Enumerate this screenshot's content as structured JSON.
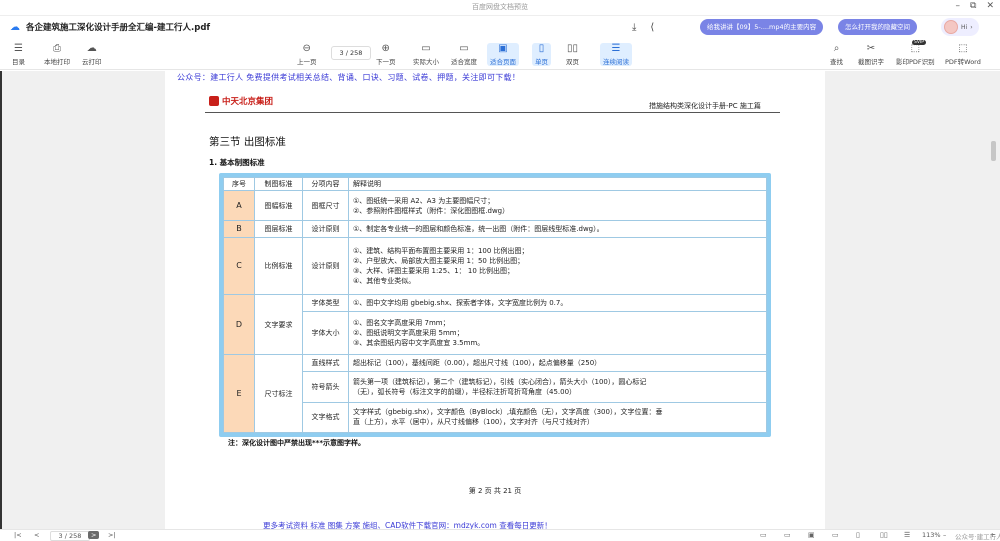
{
  "window": {
    "title": "百度网盘文档预览",
    "minimize": "–",
    "restore": "⧉",
    "close": "✕"
  },
  "file": {
    "name": "各企建筑施工深化设计手册全汇编-建工行人.pdf"
  },
  "header": {
    "download_icon": "download-icon",
    "share_icon": "share-icon",
    "pill1": "给我讲讲【09】5-....mp4的主要内容",
    "pill2": "怎么打开我的隐藏空间",
    "avatar_label": "Hi",
    "assistant_more": "›"
  },
  "toolbar": {
    "left": [
      {
        "label": "目录",
        "icon": "☰"
      },
      {
        "label": "本地打印",
        "icon": "⎙"
      },
      {
        "label": "云打印",
        "icon": "☁"
      }
    ],
    "prev": "上一页",
    "page_current": "3",
    "page_total": "/ 258",
    "next": "下一页",
    "actual_size": "实际大小",
    "fit_width": "适合宽度",
    "fit_page": "适合页面",
    "single_page": "单页",
    "double_page": "双页",
    "continuous": "连续阅读",
    "right": [
      {
        "label": "查找",
        "icon": "⌕"
      },
      {
        "label": "截图识字",
        "icon": "✂"
      },
      {
        "label": "影印PDF识别",
        "icon": "⬚"
      },
      {
        "label": "PDF转Word",
        "icon": "⬚"
      }
    ],
    "svip_badge": "SVIP"
  },
  "document": {
    "notice": "公众号：建工行人 免费提供考试相关总结、背诵、口诀、习题、试卷、押题，关注即可下载！",
    "logo_text": "中天北京集团",
    "header_title": "措施结构类深化设计手册-PC 施工篇",
    "section_title": "第三节  出图标准",
    "subsection": "1.    基本制图标准",
    "table_headers": [
      "序号",
      "制图标准",
      "分项内容",
      "解释说明"
    ],
    "rows": {
      "A": {
        "code": "A",
        "cat": "图幅标准",
        "sub": "图框尺寸",
        "lines": [
          "①、图纸统一采用  A2、A3  为主要图幅尺寸；",
          "②、参照附件图框样式（附件：深化图图框.dwg）"
        ]
      },
      "B": {
        "code": "B",
        "cat": "图层标准",
        "sub": "设计原则",
        "lines": [
          "①、制定各专业统一的图层和颜色标准，统一出图（附件：图层线型标准.dwg）。"
        ]
      },
      "C": {
        "code": "C",
        "cat": "比例标准",
        "sub": "设计原则",
        "lines": [
          "①、建筑、结构平面布置图主要采用  1：100  比例出图；",
          "②、户型放大、局部放大图主要采用  1：50  比例出图；",
          "③、大样、详图主要采用  1:25、1：  10  比例出图；",
          "④、其他专业类似。"
        ]
      },
      "D": {
        "code": "D",
        "cat": "文字要求",
        "sub1": "字体类型",
        "lines1": [
          "①、图中文字均用  gbebig.shx、探索者字体，文字宽度比例为  0.7。"
        ],
        "sub2": "字体大小",
        "lines2": [
          "①、图名文字高度采用  7mm；",
          "②、图纸说明文字高度采用  5mm；",
          "③、其余图纸内容中文字高度宜  3.5mm。"
        ]
      },
      "E": {
        "code": "E",
        "cat": "尺寸标注",
        "sub1": "直线样式",
        "lines1": [
          "超出标记（100），基线间距（0.00），超出尺寸线（100），起点偏移量（250）"
        ],
        "sub2": "符号箭头",
        "lines2": [
          "箭头第一项（建筑标记），第二个（建筑标记），引线（实心闭合），箭头大小（100），圆心标记",
          "（无），弧长符号（标注文字的前缀），半径标注折弯折弯角度（45.00）"
        ],
        "sub3": "文字格式",
        "lines3": [
          "文字样式（gbebig.shx），文字颜色（ByBlock）,填充颜色（无），文字高度（300），文字位置：垂",
          "直（上方），水平（居中），从尺寸线偏移（100），文字对齐（与尺寸线对齐）"
        ]
      }
    },
    "note": "注：深化设计图中严禁出现***示意图字样。",
    "page_number": "第 2 页 共 21 页",
    "footer_link": "更多考试资料  标准  图集  方案  施组、CAD软件下载官网：mdzyk.com  查看每日更新！"
  },
  "statusbar": {
    "first": "|<",
    "prev": "<",
    "page": "3",
    "total": "/ 258",
    "next": ">",
    "last": ">|",
    "zoom": "113%",
    "zoom_minus": "–",
    "zoom_plus": "+",
    "watermark": "公众号·建工行人"
  }
}
